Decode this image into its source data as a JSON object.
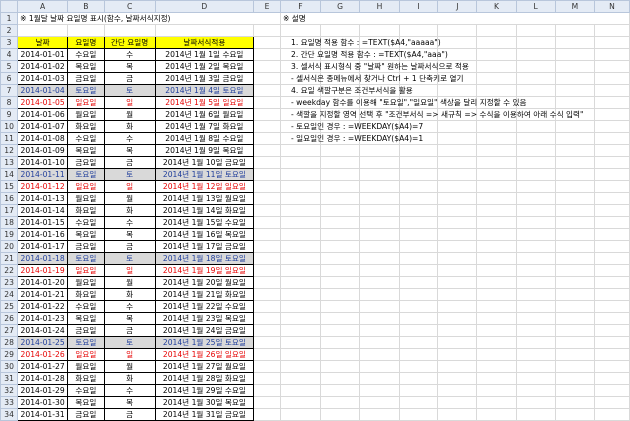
{
  "columns": [
    "",
    "A",
    "B",
    "C",
    "D",
    "E",
    "F",
    "G",
    "H",
    "I",
    "J",
    "K",
    "L",
    "M",
    "N"
  ],
  "title_cell": "※ 1월달 날짜 요일명 표시(함수, 날짜서식지정)",
  "notes_title": "※ 설명",
  "headers": {
    "date": "날짜",
    "day": "요일명",
    "short": "간단 요일명",
    "fmt": "날짜서식적용"
  },
  "notes": [
    "1. 요일명 적용 함수 : =TEXT($A4,\"aaaaa\")",
    "2. 간단 요일명 적용 함수 : =TEXT($A4,\"aaa\")",
    "3. 셀서식 표시형식 중 \"날짜\" 원하는 날짜서식으로 적용",
    " - 셀서식은 종메뉴에서 찾거나 Ctrl + 1 단축키로 열기",
    "4. 요일 색깔구분은 조건부서식을 활용",
    " - weekday 함수를 이용해 \"토요일\",\"일요일\" 색상을 달리 지정할 수 있음",
    " - 색깔을 지정할 영역 선택 후 \"조건부서식 => 새규칙 => 수식을 이용하여 아래 수식 입력\"",
    " - 토요일인 경우 : =WEEKDAY($A4)=7",
    " - 일요일인 경우 : =WEEKDAY($A4)=1"
  ],
  "rows": [
    {
      "n": "4",
      "date": "2014-01-01",
      "day": "수요일",
      "short": "수",
      "fmt": "2014년 1월 1일 수요일",
      "type": ""
    },
    {
      "n": "5",
      "date": "2014-01-02",
      "day": "목요일",
      "short": "목",
      "fmt": "2014년 1월 2일 목요일",
      "type": ""
    },
    {
      "n": "6",
      "date": "2014-01-03",
      "day": "금요일",
      "short": "금",
      "fmt": "2014년 1월 3일 금요일",
      "type": ""
    },
    {
      "n": "7",
      "date": "2014-01-04",
      "day": "토요일",
      "short": "토",
      "fmt": "2014년 1월 4일 토요일",
      "type": "sat"
    },
    {
      "n": "8",
      "date": "2014-01-05",
      "day": "일요일",
      "short": "일",
      "fmt": "2014년 1월 5일 일요일",
      "type": "sun"
    },
    {
      "n": "9",
      "date": "2014-01-06",
      "day": "월요일",
      "short": "월",
      "fmt": "2014년 1월 6일 월요일",
      "type": ""
    },
    {
      "n": "10",
      "date": "2014-01-07",
      "day": "화요일",
      "short": "화",
      "fmt": "2014년 1월 7일 화요일",
      "type": ""
    },
    {
      "n": "11",
      "date": "2014-01-08",
      "day": "수요일",
      "short": "수",
      "fmt": "2014년 1월 8일 수요일",
      "type": ""
    },
    {
      "n": "12",
      "date": "2014-01-09",
      "day": "목요일",
      "short": "목",
      "fmt": "2014년 1월 9일 목요일",
      "type": ""
    },
    {
      "n": "13",
      "date": "2014-01-10",
      "day": "금요일",
      "short": "금",
      "fmt": "2014년 1월 10일 금요일",
      "type": ""
    },
    {
      "n": "14",
      "date": "2014-01-11",
      "day": "토요일",
      "short": "토",
      "fmt": "2014년 1월 11일 토요일",
      "type": "sat"
    },
    {
      "n": "15",
      "date": "2014-01-12",
      "day": "일요일",
      "short": "일",
      "fmt": "2014년 1월 12일 일요일",
      "type": "sun"
    },
    {
      "n": "16",
      "date": "2014-01-13",
      "day": "월요일",
      "short": "월",
      "fmt": "2014년 1월 13일 월요일",
      "type": ""
    },
    {
      "n": "17",
      "date": "2014-01-14",
      "day": "화요일",
      "short": "화",
      "fmt": "2014년 1월 14일 화요일",
      "type": ""
    },
    {
      "n": "18",
      "date": "2014-01-15",
      "day": "수요일",
      "short": "수",
      "fmt": "2014년 1월 15일 수요일",
      "type": ""
    },
    {
      "n": "19",
      "date": "2014-01-16",
      "day": "목요일",
      "short": "목",
      "fmt": "2014년 1월 16일 목요일",
      "type": ""
    },
    {
      "n": "20",
      "date": "2014-01-17",
      "day": "금요일",
      "short": "금",
      "fmt": "2014년 1월 17일 금요일",
      "type": ""
    },
    {
      "n": "21",
      "date": "2014-01-18",
      "day": "토요일",
      "short": "토",
      "fmt": "2014년 1월 18일 토요일",
      "type": "sat"
    },
    {
      "n": "22",
      "date": "2014-01-19",
      "day": "일요일",
      "short": "일",
      "fmt": "2014년 1월 19일 일요일",
      "type": "sun"
    },
    {
      "n": "23",
      "date": "2014-01-20",
      "day": "월요일",
      "short": "월",
      "fmt": "2014년 1월 20일 월요일",
      "type": ""
    },
    {
      "n": "24",
      "date": "2014-01-21",
      "day": "화요일",
      "short": "화",
      "fmt": "2014년 1월 21일 화요일",
      "type": ""
    },
    {
      "n": "25",
      "date": "2014-01-22",
      "day": "수요일",
      "short": "수",
      "fmt": "2014년 1월 22일 수요일",
      "type": ""
    },
    {
      "n": "26",
      "date": "2014-01-23",
      "day": "목요일",
      "short": "목",
      "fmt": "2014년 1월 23일 목요일",
      "type": ""
    },
    {
      "n": "27",
      "date": "2014-01-24",
      "day": "금요일",
      "short": "금",
      "fmt": "2014년 1월 24일 금요일",
      "type": ""
    },
    {
      "n": "28",
      "date": "2014-01-25",
      "day": "토요일",
      "short": "토",
      "fmt": "2014년 1월 25일 토요일",
      "type": "sat"
    },
    {
      "n": "29",
      "date": "2014-01-26",
      "day": "일요일",
      "short": "일",
      "fmt": "2014년 1월 26일 일요일",
      "type": "sun"
    },
    {
      "n": "30",
      "date": "2014-01-27",
      "day": "월요일",
      "short": "월",
      "fmt": "2014년 1월 27일 월요일",
      "type": ""
    },
    {
      "n": "31",
      "date": "2014-01-28",
      "day": "화요일",
      "short": "화",
      "fmt": "2014년 1월 28일 화요일",
      "type": ""
    },
    {
      "n": "32",
      "date": "2014-01-29",
      "day": "수요일",
      "short": "수",
      "fmt": "2014년 1월 29일 수요일",
      "type": ""
    },
    {
      "n": "33",
      "date": "2014-01-30",
      "day": "목요일",
      "short": "목",
      "fmt": "2014년 1월 30일 목요일",
      "type": ""
    },
    {
      "n": "34",
      "date": "2014-01-31",
      "day": "금요일",
      "short": "금",
      "fmt": "2014년 1월 31일 금요일",
      "type": ""
    }
  ],
  "colors": {
    "saturday_text": "#1f3d9a",
    "saturday_fill": "#d9d9d9",
    "sunday_text": "#e60000",
    "header_fill": "#ffff00"
  }
}
